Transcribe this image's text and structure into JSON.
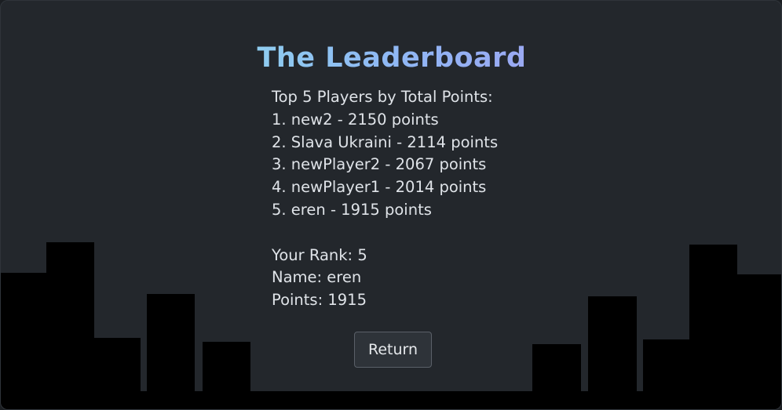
{
  "title": "The Leaderboard",
  "subtitle": "Top 5 Players by Total Points:",
  "leaderboard": [
    {
      "text": "1. new2 - 2150 points"
    },
    {
      "text": "2. Slava Ukraini - 2114 points"
    },
    {
      "text": "3. newPlayer2 - 2067 points"
    },
    {
      "text": "4. newPlayer1 - 2014 points"
    },
    {
      "text": "5. eren - 1915 points"
    }
  ],
  "you": {
    "rank_line": "Your Rank: 5",
    "name_line": "Name: eren",
    "points_line": "Points: 1915"
  },
  "return_label": "Return",
  "colors": {
    "background": "#23272c",
    "skyline": "#000000",
    "text": "#dfe3e8",
    "title_gradient": [
      "#8ff3e8",
      "#8fb8f4",
      "#b08cf0"
    ]
  }
}
